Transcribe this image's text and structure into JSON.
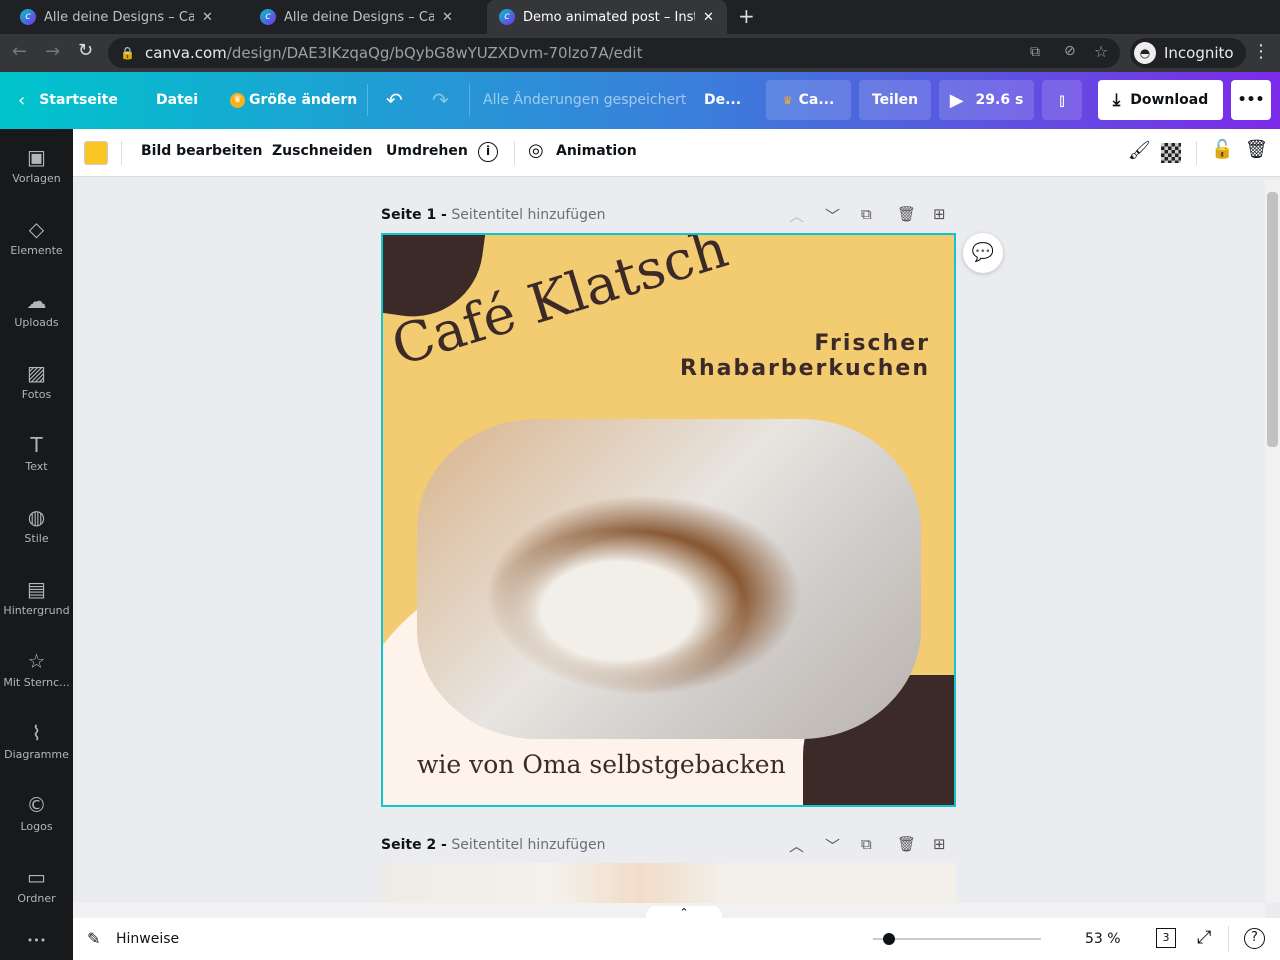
{
  "browser": {
    "tabs": [
      {
        "title": "Alle deine Designs – Canva"
      },
      {
        "title": "Alle deine Designs – Canva"
      },
      {
        "title": "Demo animated post – Instagram"
      }
    ],
    "url_domain": "canva.com",
    "url_path": "/design/DAE3IKzqaQg/bQybG8wYUZXDvm-70lzo7A/edit",
    "profile": "Incognito"
  },
  "header": {
    "home": "Startseite",
    "file": "Datei",
    "resize": "Größe ändern",
    "saved": "Alle Änderungen gespeichert",
    "title": "De...",
    "canva_pro": "Ca...",
    "share": "Teilen",
    "duration": "29.6 s",
    "download": "Download"
  },
  "toolbar": {
    "edit_image": "Bild bearbeiten",
    "crop": "Zuschneiden",
    "flip": "Umdrehen",
    "animation": "Animation",
    "color": "#f9c623"
  },
  "sidebar": [
    {
      "label": "Vorlagen",
      "icon": "▣"
    },
    {
      "label": "Elemente",
      "icon": "◇"
    },
    {
      "label": "Uploads",
      "icon": "☁"
    },
    {
      "label": "Fotos",
      "icon": "▨"
    },
    {
      "label": "Text",
      "icon": "T"
    },
    {
      "label": "Stile",
      "icon": "◍"
    },
    {
      "label": "Hintergrund",
      "icon": "▤"
    },
    {
      "label": "Mit Sternc...",
      "icon": "☆"
    },
    {
      "label": "Diagramme",
      "icon": "⌇"
    },
    {
      "label": "Logos",
      "icon": "©"
    },
    {
      "label": "Ordner",
      "icon": "▭"
    }
  ],
  "pages": [
    {
      "label": "Seite 1 -",
      "subtitle": "Seitentitel hinzufügen"
    },
    {
      "label": "Seite 2 -",
      "subtitle": "Seitentitel hinzufügen"
    }
  ],
  "design": {
    "title": "Café Klatsch",
    "subtitle_line1": "Frischer",
    "subtitle_line2": "Rhabarberkuchen",
    "tagline": "wie von Oma selbstgebacken"
  },
  "bottom": {
    "notes": "Hinweise",
    "zoom": "53 %",
    "page_count": "3",
    "zoom_fraction": 0.06
  }
}
